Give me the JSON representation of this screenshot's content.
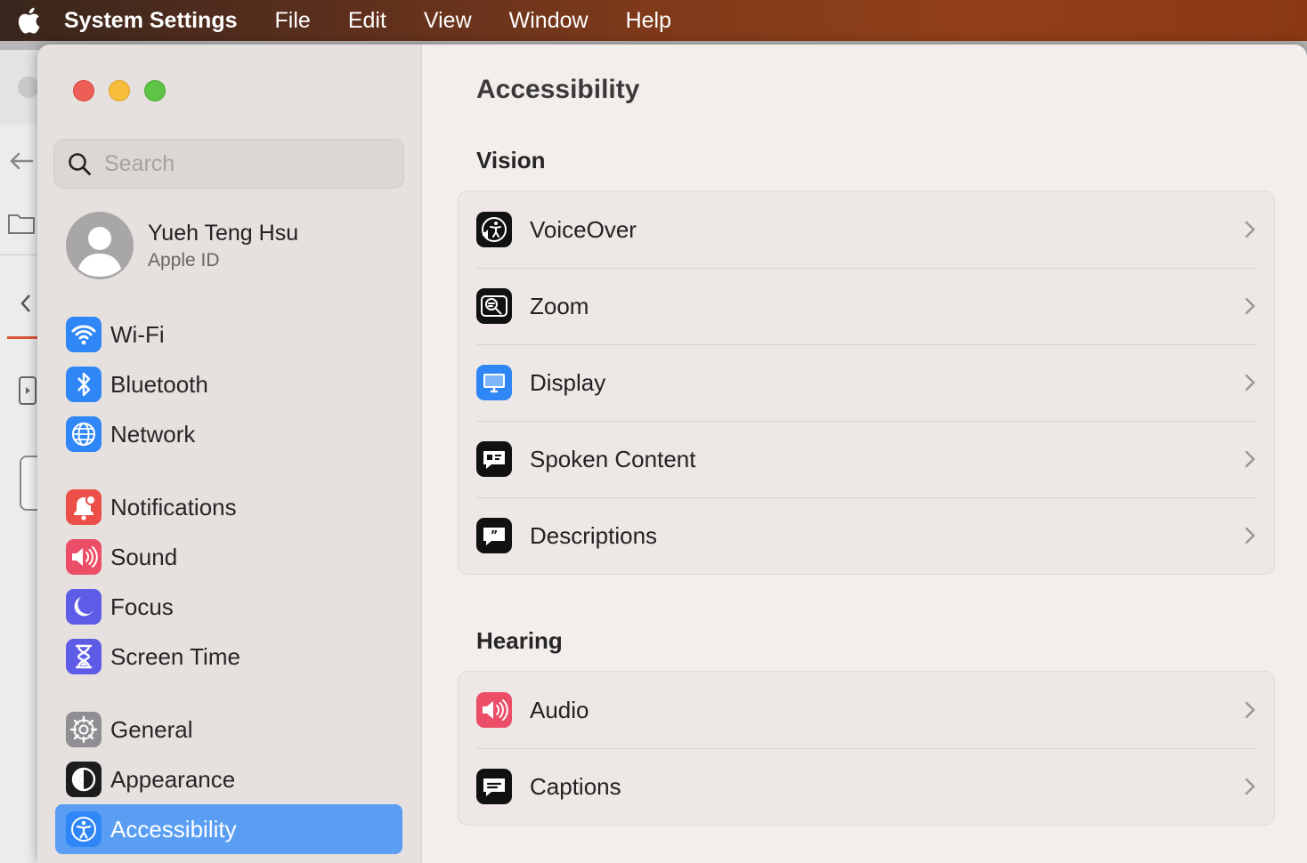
{
  "menubar": {
    "app_name": "System Settings",
    "items": [
      "File",
      "Edit",
      "View",
      "Window",
      "Help"
    ]
  },
  "sidebar": {
    "search_placeholder": "Search",
    "profile": {
      "name": "Yueh Teng Hsu",
      "subtitle": "Apple ID"
    },
    "items": [
      {
        "label": "Wi-Fi",
        "icon": "wifi-icon",
        "color": "#2f86f6"
      },
      {
        "label": "Bluetooth",
        "icon": "bluetooth-icon",
        "color": "#2f86f6"
      },
      {
        "label": "Network",
        "icon": "globe-icon",
        "color": "#2f86f6"
      },
      {
        "label": "Notifications",
        "icon": "bell-icon",
        "color": "#ec4f48"
      },
      {
        "label": "Sound",
        "icon": "speaker-icon",
        "color": "#ec4d67"
      },
      {
        "label": "Focus",
        "icon": "moon-icon",
        "color": "#5e5ce6"
      },
      {
        "label": "Screen Time",
        "icon": "hourglass-icon",
        "color": "#5e5ce6"
      },
      {
        "label": "General",
        "icon": "gear-icon",
        "color": "#8e8e93"
      },
      {
        "label": "Appearance",
        "icon": "appearance-icon",
        "color": "#1c1c1e"
      },
      {
        "label": "Accessibility",
        "icon": "accessibility-icon",
        "color": "#2f86f6",
        "selected": true
      }
    ]
  },
  "content": {
    "title": "Accessibility",
    "vision": {
      "title": "Vision",
      "rows": [
        {
          "label": "VoiceOver",
          "icon": "voiceover-icon"
        },
        {
          "label": "Zoom",
          "icon": "zoom-icon"
        },
        {
          "label": "Display",
          "icon": "display-icon"
        },
        {
          "label": "Spoken Content",
          "icon": "spoken-content-icon"
        },
        {
          "label": "Descriptions",
          "icon": "descriptions-icon"
        }
      ]
    },
    "hearing": {
      "title": "Hearing",
      "rows": [
        {
          "label": "Audio",
          "icon": "audio-icon"
        },
        {
          "label": "Captions",
          "icon": "captions-icon"
        }
      ]
    }
  }
}
